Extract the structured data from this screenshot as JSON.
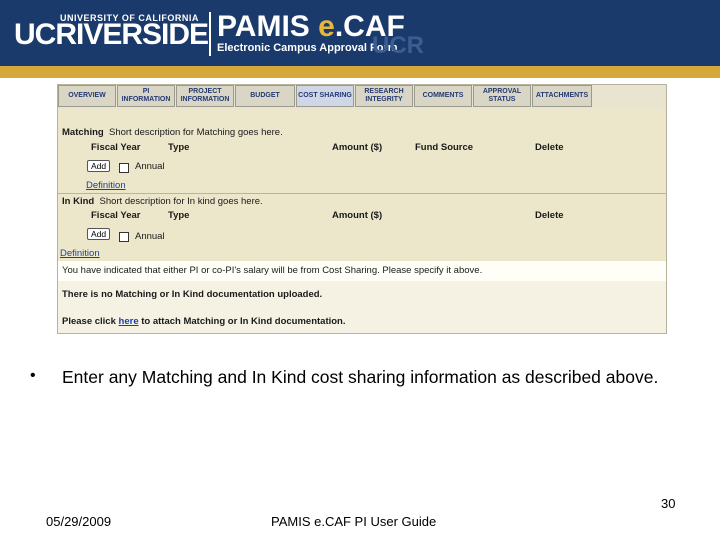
{
  "header": {
    "logo_ucr": "UCRIVERSIDE",
    "university_line": "UNIVERSITY OF CALIFORNIA",
    "app_name_prefix": "PAMIS ",
    "app_name_e": "e",
    "app_name_suffix": ".CAF",
    "app_subtitle": "Electronic Campus Approval Form",
    "watermark": "UCR"
  },
  "tabs": [
    {
      "label": "OVERVIEW"
    },
    {
      "label": "PI INFORMATION"
    },
    {
      "label": "PROJECT INFORMATION"
    },
    {
      "label": "BUDGET"
    },
    {
      "label": "COST SHARING"
    },
    {
      "label": "RESEARCH INTEGRITY"
    },
    {
      "label": "COMMENTS"
    },
    {
      "label": "APPROVAL STATUS"
    },
    {
      "label": "ATTACHMENTS"
    }
  ],
  "matching": {
    "label": "Matching",
    "description": "Short description for Matching goes here.",
    "columns": {
      "fiscal_year": "Fiscal Year",
      "type": "Type",
      "amount": "Amount ($)",
      "fund_source": "Fund Source",
      "delete": "Delete"
    },
    "add_label": "Add",
    "annual_label": "Annual",
    "definition_link": "Definition"
  },
  "in_kind": {
    "label": "In Kind",
    "description": "Short description for In kind goes here.",
    "columns": {
      "fiscal_year": "Fiscal Year",
      "type": "Type",
      "amount": "Amount ($)",
      "delete": "Delete"
    },
    "add_label": "Add",
    "annual_label": "Annual",
    "definition_link": "Definition"
  },
  "messages": {
    "cost_sharing_notice": "You have indicated that either PI or co-PI's salary will be from Cost Sharing. Please specify it above.",
    "no_documentation": "There is no Matching or In Kind documentation uploaded.",
    "attach_prefix": "Please click ",
    "attach_link": "here",
    "attach_suffix": " to attach Matching or In Kind documentation."
  },
  "slide": {
    "bullet_text": "Enter any Matching and In Kind cost sharing information as described above.",
    "page_number": "30",
    "date": "05/29/2009",
    "footer_title": "PAMIS e.CAF PI User Guide"
  }
}
